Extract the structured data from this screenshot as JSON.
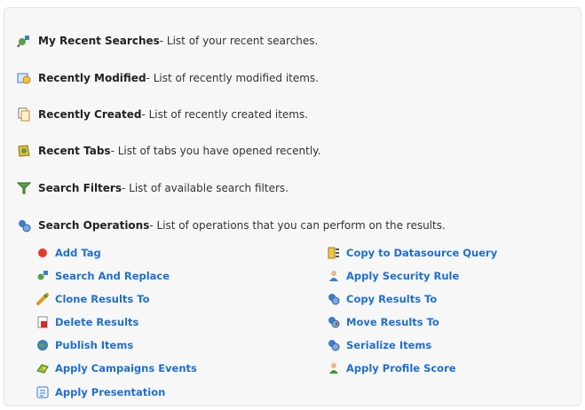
{
  "sections": [
    {
      "title": "My Recent Searches",
      "desc": " - List of your recent searches.",
      "icon": "recent-searches-icon"
    },
    {
      "title": "Recently Modified",
      "desc": " - List of recently modified items.",
      "icon": "recently-modified-icon"
    },
    {
      "title": "Recently Created",
      "desc": " - List of recently created items.",
      "icon": "recently-created-icon"
    },
    {
      "title": "Recent Tabs",
      "desc": " - List of tabs you have opened recently.",
      "icon": "recent-tabs-icon"
    },
    {
      "title": "Search Filters",
      "desc": " - List of available search filters.",
      "icon": "search-filters-icon"
    },
    {
      "title": "Search Operations",
      "desc": " - List of operations that you can perform on the results.",
      "icon": "search-operations-icon"
    }
  ],
  "operations_left": [
    {
      "label": "Add Tag",
      "icon": "add-tag-icon"
    },
    {
      "label": "Search And Replace",
      "icon": "search-replace-icon"
    },
    {
      "label": "Clone Results To",
      "icon": "clone-results-icon"
    },
    {
      "label": "Delete Results",
      "icon": "delete-results-icon"
    },
    {
      "label": "Publish Items",
      "icon": "publish-items-icon"
    },
    {
      "label": "Apply Campaigns Events",
      "icon": "campaign-events-icon"
    },
    {
      "label": "Apply Presentation",
      "icon": "presentation-icon"
    }
  ],
  "operations_right": [
    {
      "label": "Copy to Datasource Query",
      "icon": "datasource-query-icon"
    },
    {
      "label": "Apply Security Rule",
      "icon": "security-rule-icon"
    },
    {
      "label": "Copy Results To",
      "icon": "copy-results-icon"
    },
    {
      "label": "Move Results To",
      "icon": "move-results-icon"
    },
    {
      "label": "Serialize Items",
      "icon": "serialize-items-icon"
    },
    {
      "label": "Apply Profile Score",
      "icon": "profile-score-icon"
    }
  ],
  "colors": {
    "link": "#1f6fcf",
    "panel_bg": "#f7f7f8"
  }
}
